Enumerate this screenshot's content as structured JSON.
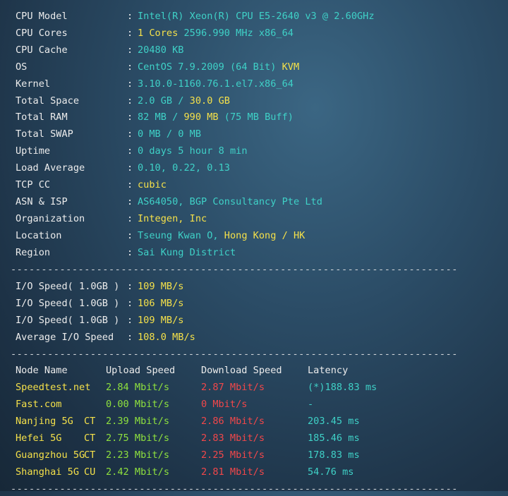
{
  "separator": "-------------------------------------------------------------------------",
  "system_info": [
    {
      "key": "CPU Model",
      "parts": [
        {
          "t": "Intel(R) Xeon(R) CPU E5-2640 v3 @ 2.60GHz",
          "c": "c"
        }
      ]
    },
    {
      "key": "CPU Cores",
      "parts": [
        {
          "t": "1 Cores ",
          "c": "y"
        },
        {
          "t": "2596.990 MHz x86_64",
          "c": "c"
        }
      ]
    },
    {
      "key": "CPU Cache",
      "parts": [
        {
          "t": "20480 KB",
          "c": "c"
        }
      ]
    },
    {
      "key": "OS",
      "parts": [
        {
          "t": "CentOS 7.9.2009 (64 Bit) ",
          "c": "c"
        },
        {
          "t": "KVM",
          "c": "y"
        }
      ]
    },
    {
      "key": "Kernel",
      "parts": [
        {
          "t": "3.10.0-1160.76.1.el7.x86_64",
          "c": "c"
        }
      ]
    },
    {
      "key": "Total Space",
      "parts": [
        {
          "t": "2.0 GB / ",
          "c": "c"
        },
        {
          "t": "30.0 GB",
          "c": "y"
        }
      ]
    },
    {
      "key": "Total RAM",
      "parts": [
        {
          "t": "82 MB / ",
          "c": "c"
        },
        {
          "t": "990 MB",
          "c": "y"
        },
        {
          "t": " (75 MB Buff)",
          "c": "c"
        }
      ]
    },
    {
      "key": "Total SWAP",
      "parts": [
        {
          "t": "0 MB / 0 MB",
          "c": "c"
        }
      ]
    },
    {
      "key": "Uptime",
      "parts": [
        {
          "t": "0 days 5 hour 8 min",
          "c": "c"
        }
      ]
    },
    {
      "key": "Load Average",
      "parts": [
        {
          "t": "0.10, 0.22, 0.13",
          "c": "c"
        }
      ]
    },
    {
      "key": "TCP CC",
      "parts": [
        {
          "t": "cubic",
          "c": "y"
        }
      ]
    },
    {
      "key": "ASN & ISP",
      "parts": [
        {
          "t": "AS64050, BGP Consultancy Pte Ltd",
          "c": "c"
        }
      ]
    },
    {
      "key": "Organization",
      "parts": [
        {
          "t": "Integen, Inc",
          "c": "y"
        }
      ]
    },
    {
      "key": "Location",
      "parts": [
        {
          "t": "Tseung Kwan O, ",
          "c": "c"
        },
        {
          "t": "Hong Kong / HK",
          "c": "y"
        }
      ]
    },
    {
      "key": "Region",
      "parts": [
        {
          "t": "Sai Kung District",
          "c": "c"
        }
      ]
    }
  ],
  "io_speed": [
    {
      "key": "I/O Speed( 1.0GB )",
      "value": "109 MB/s"
    },
    {
      "key": "I/O Speed( 1.0GB )",
      "value": "106 MB/s"
    },
    {
      "key": "I/O Speed( 1.0GB )",
      "value": "109 MB/s"
    },
    {
      "key": "Average I/O Speed",
      "value": "108.0 MB/s"
    }
  ],
  "speed_table": {
    "headers": [
      "Node Name",
      "Upload Speed",
      "Download Speed",
      "Latency"
    ],
    "rows": [
      {
        "node": "Speedtest.net",
        "isp": "",
        "upload": "2.84 Mbit/s",
        "download": "2.87 Mbit/s",
        "latency": "(*)188.83 ms"
      },
      {
        "node": "Fast.com",
        "isp": "",
        "upload": "0.00 Mbit/s",
        "download": "0 Mbit/s",
        "latency": "-"
      },
      {
        "node": "Nanjing 5G",
        "isp": "CT",
        "upload": "2.39 Mbit/s",
        "download": "2.86 Mbit/s",
        "latency": "203.45 ms"
      },
      {
        "node": "Hefei 5G",
        "isp": "CT",
        "upload": "2.75 Mbit/s",
        "download": "2.83 Mbit/s",
        "latency": "185.46 ms"
      },
      {
        "node": "Guangzhou 5G",
        "isp": "CT",
        "upload": "2.23 Mbit/s",
        "download": "2.25 Mbit/s",
        "latency": "178.83 ms"
      },
      {
        "node": "Shanghai 5G",
        "isp": "CU",
        "upload": "2.42 Mbit/s",
        "download": "2.81 Mbit/s",
        "latency": "54.76 ms"
      }
    ]
  },
  "colors": {
    "key": "#ececec",
    "cyan": "#3fd1c7",
    "yellow": "#f4e04a",
    "green": "#8ee03e",
    "red": "#f2474a"
  }
}
